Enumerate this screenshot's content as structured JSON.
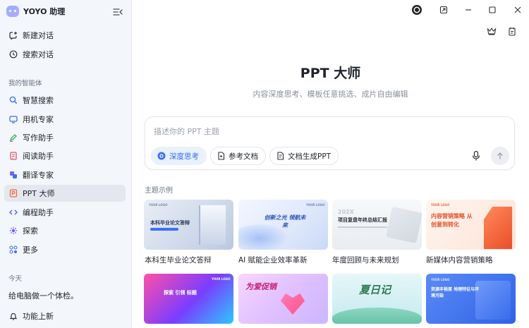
{
  "app": {
    "name": "YOYO 助理"
  },
  "sidebar": {
    "top_items": [
      {
        "label": "新建对话",
        "icon": "new-chat-icon"
      },
      {
        "label": "搜索对话",
        "icon": "history-icon"
      }
    ],
    "agents_section": "我的智能体",
    "agents": [
      {
        "label": "智慧搜索",
        "icon": "search-icon"
      },
      {
        "label": "用机专家",
        "icon": "phone-icon"
      },
      {
        "label": "写作助手",
        "icon": "pen-icon"
      },
      {
        "label": "阅读助手",
        "icon": "document-icon"
      },
      {
        "label": "翻译专家",
        "icon": "translate-icon"
      },
      {
        "label": "PPT 大师",
        "icon": "ppt-icon"
      },
      {
        "label": "编程助手",
        "icon": "code-icon"
      },
      {
        "label": "探索",
        "icon": "explore-icon"
      },
      {
        "label": "更多",
        "icon": "grid-icon"
      }
    ],
    "today_section": "今天",
    "history": [
      {
        "label": "给电脑做一个体检。"
      }
    ],
    "footer_item": {
      "label": "功能上新",
      "icon": "bell-icon"
    }
  },
  "main": {
    "title": "PPT 大师",
    "subtitle": "内容深度思考、模板任意挑选、成片自由编辑",
    "input": {
      "placeholder": "描述你的 PPT 主题"
    },
    "chips": [
      {
        "label": "深度思考",
        "icon": "deep-think-icon",
        "active": true
      },
      {
        "label": "参考文档",
        "icon": "attach-document-icon",
        "active": false
      },
      {
        "label": "文档生成PPT",
        "icon": "doc-to-ppt-icon",
        "active": false
      }
    ],
    "examples_label": "主题示例",
    "examples": [
      {
        "title": "本科生毕业论文答辩",
        "thumb_text": "本科毕业论文答辩",
        "thumb_logo": "YOUR LOGO"
      },
      {
        "title": "AI 赋能企业效率革新",
        "thumb_text": "创新之光 领航未来",
        "thumb_logo": "YOUR LOGO"
      },
      {
        "title": "年度回顾与未来规划",
        "thumb_text": "项目复盘年终总结汇报",
        "thumb_logo": "YOUR LOGO",
        "thumb_year": "202X"
      },
      {
        "title": "新媒体内容营销策略",
        "thumb_text": "内容营销策略 从创意到转化",
        "thumb_logo": "YOUR LOGO"
      },
      {
        "title": "",
        "thumb_text": "探索 引领 标题",
        "thumb_logo": "YOUR LOGO"
      },
      {
        "title": "",
        "thumb_text": "为爱促销",
        "thumb_logo": ""
      },
      {
        "title": "",
        "thumb_text": "夏日记",
        "thumb_logo": ""
      },
      {
        "title": "",
        "thumb_text": "资源丰裕度 地理特征与环境污染",
        "thumb_logo": "YOUR LOGO"
      }
    ]
  }
}
